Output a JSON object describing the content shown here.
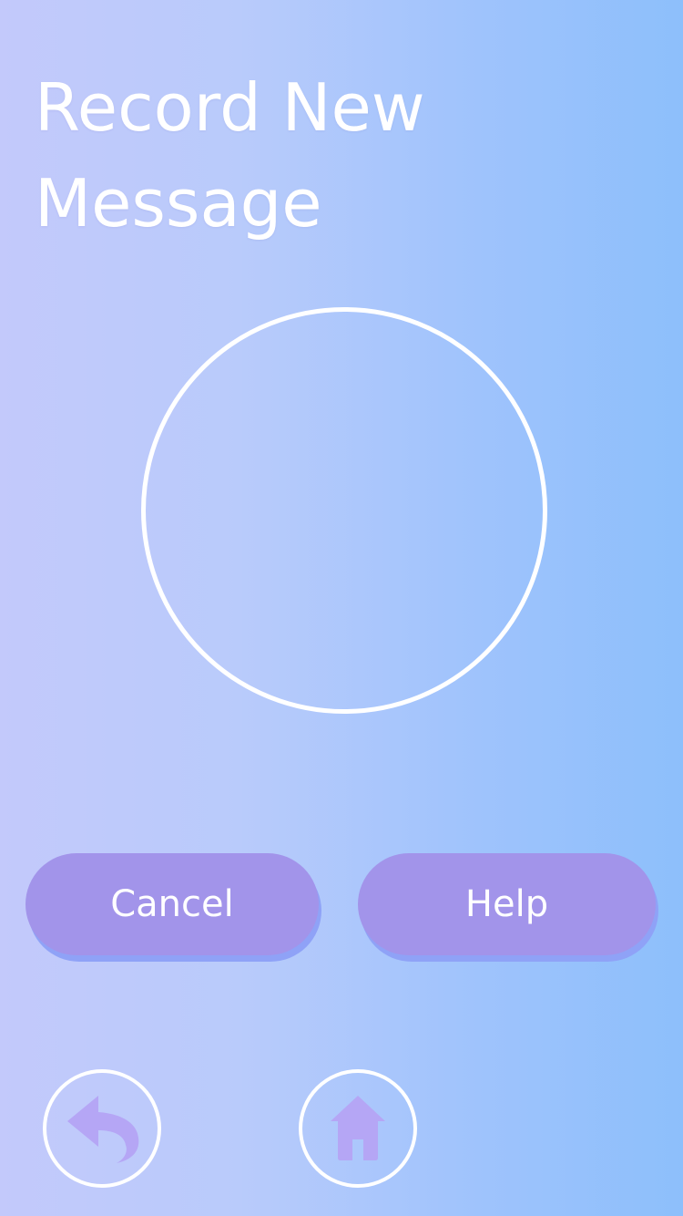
{
  "header": {
    "title": "Record New Message"
  },
  "record": {
    "control": "record-circle"
  },
  "actions": {
    "cancel_label": "Cancel",
    "help_label": "Help"
  },
  "nav": {
    "back_icon": "back-arrow-icon",
    "home_icon": "home-icon"
  },
  "colors": {
    "background_left": "#c3c9fb",
    "background_right": "#8dbffb",
    "button_fill": "#a294ea",
    "button_shadow": "#8fa2f7",
    "icon_fill": "#b5a6f5",
    "text": "#ffffff"
  }
}
